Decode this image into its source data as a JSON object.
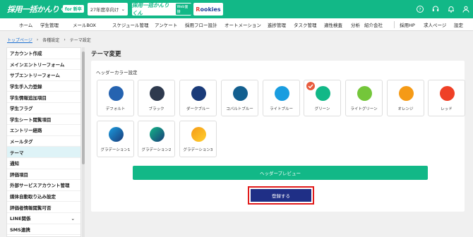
{
  "header": {
    "brand": "採用一括かんりくん",
    "brand_badge": "for 新卒",
    "year_select": "27年度卒向け",
    "tool_a_name": "採用一括かんりくん",
    "tool_a_badge": "Web面接",
    "tool_b_left": "R",
    "tool_b_right": "ookies",
    "colors": {
      "brand": "#12b887"
    },
    "icons": [
      "help-icon",
      "support-icon",
      "bell-icon",
      "user-icon"
    ]
  },
  "nav": {
    "items": [
      "ホーム",
      "学生管理",
      "メールBOX",
      "スケジュール管理",
      "アンケート",
      "採用フロー設計",
      "オートメーション",
      "進捗管理",
      "タスク管理",
      "適性検査",
      "分析",
      "紹介会社",
      "採用HP",
      "求人ページ",
      "設定"
    ]
  },
  "breadcrumb": {
    "home": "トップページ",
    "settings": "各種設定",
    "current": "テーマ設定"
  },
  "sidebar": {
    "items": [
      {
        "label": "アカウント作成"
      },
      {
        "label": "メインエントリーフォーム"
      },
      {
        "label": "サブエントリーフォーム"
      },
      {
        "label": "学生手入力登録"
      },
      {
        "label": "学生情報追加項目"
      },
      {
        "label": "学生フラグ"
      },
      {
        "label": "学生シート閲覧項目"
      },
      {
        "label": "エントリー経路"
      },
      {
        "label": "メールタグ"
      },
      {
        "label": "テーマ"
      },
      {
        "label": "通知"
      },
      {
        "label": "評価項目"
      },
      {
        "label": "外部サービスアカウント管理"
      },
      {
        "label": "媒体自動取り込み設定"
      },
      {
        "label": "評価者情報閲覧可否"
      },
      {
        "label": "LINE関係"
      },
      {
        "label": "SMS連携"
      }
    ],
    "active": "テーマ"
  },
  "main": {
    "title": "テーマ変更",
    "section_label": "ヘッダーカラー設定",
    "selected": "グリーン",
    "swatches": [
      {
        "label": "デフォルト",
        "color": "#2563b0"
      },
      {
        "label": "ブラック",
        "color": "#2e3a4e"
      },
      {
        "label": "ダークブルー",
        "color": "#1a3b79"
      },
      {
        "label": "コバルトブルー",
        "color": "#135f8f"
      },
      {
        "label": "ライトブルー",
        "color": "#1a9de0"
      },
      {
        "label": "グリーン",
        "color": "#12b887"
      },
      {
        "label": "ライトグリーン",
        "color": "#74c63a"
      },
      {
        "label": "オレンジ",
        "color": "#f59a16"
      },
      {
        "label": "レッド",
        "color": "#ef4026"
      },
      {
        "label": "グラデーション1",
        "color": "#1a9de0",
        "color2": "#1a3b79"
      },
      {
        "label": "グラデーション2",
        "color": "#12b887",
        "color2": "#1a3b79"
      },
      {
        "label": "グラデーション3",
        "color": "#f59a16",
        "color2": "#ffcf2e"
      }
    ],
    "preview_label": "ヘッダープレビュー",
    "register_label": "登録する",
    "colors": {
      "register": "#1f2f86",
      "highlight": "#e11b1b",
      "check": "#e85b3d"
    }
  }
}
